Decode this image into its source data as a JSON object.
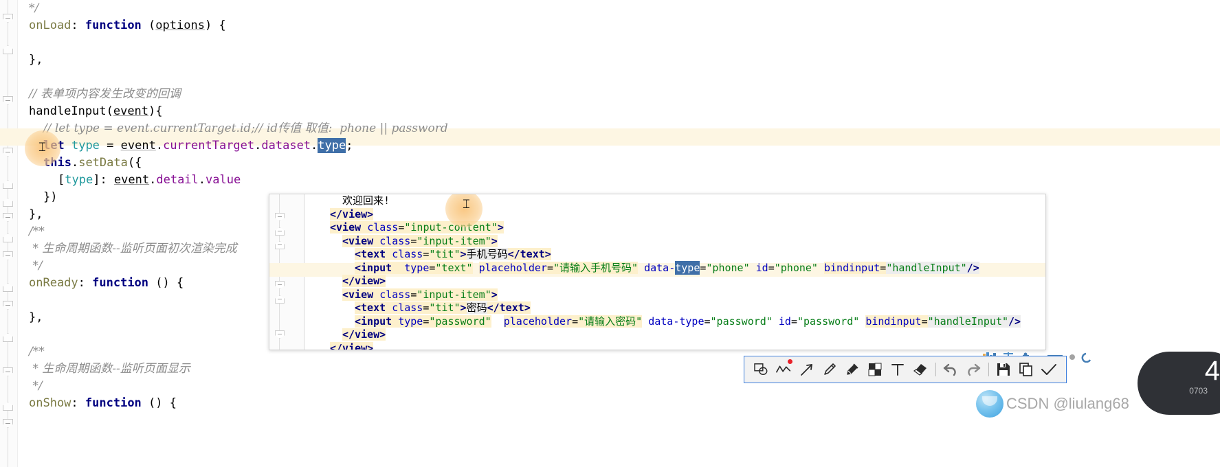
{
  "editor": {
    "lines": [
      {
        "indent": 0,
        "segments": [
          {
            "t": "*/",
            "c": "comment"
          }
        ]
      },
      {
        "indent": 0,
        "segments": [
          {
            "t": "onLoad",
            "c": "fn"
          },
          {
            "t": ": ",
            "c": "punc"
          },
          {
            "t": "function",
            "c": "kw"
          },
          {
            "t": " (",
            "c": "punc"
          },
          {
            "t": "options",
            "c": "param"
          },
          {
            "t": ") {",
            "c": "punc"
          }
        ]
      },
      {
        "indent": 0,
        "segments": []
      },
      {
        "indent": 0,
        "segments": [
          {
            "t": "},",
            "c": "punc"
          }
        ]
      },
      {
        "indent": 0,
        "segments": []
      },
      {
        "indent": 0,
        "segments": [
          {
            "t": "// 表单项内容发生改变的回调",
            "c": "comment"
          }
        ]
      },
      {
        "indent": 0,
        "segments": [
          {
            "t": "handleInput",
            "c": "ident"
          },
          {
            "t": "(",
            "c": "punc"
          },
          {
            "t": "event",
            "c": "param"
          },
          {
            "t": "){",
            "c": "punc"
          }
        ]
      },
      {
        "indent": 1,
        "segments": [
          {
            "t": "// let type = event.currentTarget.id;// id传值 取值:  phone || password",
            "c": "comment"
          }
        ]
      },
      {
        "indent": 1,
        "segments": [
          {
            "t": "let",
            "c": "kw"
          },
          {
            "t": " ",
            "c": "punc"
          },
          {
            "t": "type",
            "c": "teal"
          },
          {
            "t": " = ",
            "c": "punc"
          },
          {
            "t": "event",
            "c": "param"
          },
          {
            "t": ".",
            "c": "punc"
          },
          {
            "t": "currentTarget",
            "c": "field"
          },
          {
            "t": ".",
            "c": "punc"
          },
          {
            "t": "dataset",
            "c": "field"
          },
          {
            "t": ".",
            "c": "punc"
          },
          {
            "t": "type",
            "c": "sel"
          },
          {
            "t": ";",
            "c": "punc"
          }
        ],
        "highlight": true
      },
      {
        "indent": 1,
        "segments": [
          {
            "t": "this",
            "c": "kw"
          },
          {
            "t": ".",
            "c": "punc"
          },
          {
            "t": "setData",
            "c": "fn"
          },
          {
            "t": "({",
            "c": "punc"
          }
        ]
      },
      {
        "indent": 2,
        "segments": [
          {
            "t": "[",
            "c": "punc"
          },
          {
            "t": "type",
            "c": "teal"
          },
          {
            "t": "]: ",
            "c": "punc"
          },
          {
            "t": "event",
            "c": "param"
          },
          {
            "t": ".",
            "c": "punc"
          },
          {
            "t": "detail",
            "c": "field"
          },
          {
            "t": ".",
            "c": "punc"
          },
          {
            "t": "value",
            "c": "field"
          }
        ]
      },
      {
        "indent": 1,
        "segments": [
          {
            "t": "})",
            "c": "punc"
          }
        ]
      },
      {
        "indent": 0,
        "segments": [
          {
            "t": "},",
            "c": "punc"
          }
        ]
      },
      {
        "indent": 0,
        "segments": [
          {
            "t": "/**",
            "c": "comment"
          }
        ]
      },
      {
        "indent": 0,
        "segments": [
          {
            "t": " * 生命周期函数--监听页面初次渲染完成",
            "c": "comment"
          }
        ]
      },
      {
        "indent": 0,
        "segments": [
          {
            "t": " */",
            "c": "comment"
          }
        ]
      },
      {
        "indent": 0,
        "segments": [
          {
            "t": "onReady",
            "c": "fn"
          },
          {
            "t": ": ",
            "c": "punc"
          },
          {
            "t": "function",
            "c": "kw"
          },
          {
            "t": " () {",
            "c": "punc"
          }
        ]
      },
      {
        "indent": 0,
        "segments": []
      },
      {
        "indent": 0,
        "segments": [
          {
            "t": "},",
            "c": "punc"
          }
        ]
      },
      {
        "indent": 0,
        "segments": []
      },
      {
        "indent": 0,
        "segments": [
          {
            "t": "/**",
            "c": "comment"
          }
        ]
      },
      {
        "indent": 0,
        "segments": [
          {
            "t": " * 生命周期函数--监听页面显示",
            "c": "comment"
          }
        ]
      },
      {
        "indent": 0,
        "segments": [
          {
            "t": " */",
            "c": "comment"
          }
        ]
      },
      {
        "indent": 0,
        "segments": [
          {
            "t": "onShow",
            "c": "fn"
          },
          {
            "t": ": ",
            "c": "punc"
          },
          {
            "t": "function",
            "c": "kw"
          },
          {
            "t": " () {",
            "c": "punc"
          }
        ]
      }
    ]
  },
  "overlay": {
    "lines": [
      {
        "indent": 3,
        "segments": [
          {
            "t": "欢迎回来!",
            "c": "punc"
          }
        ]
      },
      {
        "indent": 2,
        "segments": [
          {
            "t": "</view>",
            "c": "tagname",
            "hl": true
          }
        ]
      },
      {
        "indent": 2,
        "segments": [
          {
            "t": "<view ",
            "c": "tagname",
            "hl": true
          },
          {
            "t": "class",
            "c": "attr",
            "hl": true
          },
          {
            "t": "=",
            "c": "punc",
            "hl": true
          },
          {
            "t": "\"input-content\"",
            "c": "str",
            "hl": true
          },
          {
            "t": ">",
            "c": "tagname",
            "hl": true
          }
        ]
      },
      {
        "indent": 3,
        "segments": [
          {
            "t": "<view ",
            "c": "tagname",
            "hl": true
          },
          {
            "t": "class",
            "c": "attr",
            "hl": true
          },
          {
            "t": "=",
            "c": "punc",
            "hl": true
          },
          {
            "t": "\"input-item\"",
            "c": "str",
            "hl": true
          },
          {
            "t": ">",
            "c": "tagname",
            "hl": true
          }
        ]
      },
      {
        "indent": 4,
        "segments": [
          {
            "t": "<text ",
            "c": "tagname",
            "hl": true
          },
          {
            "t": "class",
            "c": "attr",
            "hl": true
          },
          {
            "t": "=",
            "c": "punc",
            "hl": true
          },
          {
            "t": "\"tit\"",
            "c": "str",
            "hl": true
          },
          {
            "t": ">",
            "c": "tagname",
            "hl": true
          },
          {
            "t": "手机号码",
            "c": "punc",
            "hl2": true
          },
          {
            "t": "</text>",
            "c": "tagname",
            "hl": true
          }
        ]
      },
      {
        "indent": 4,
        "segments": [
          {
            "t": "<input  ",
            "c": "tagname",
            "hl": true
          },
          {
            "t": "type",
            "c": "attr",
            "hl": true
          },
          {
            "t": "=",
            "c": "punc",
            "hl": true
          },
          {
            "t": "\"text\"",
            "c": "str",
            "hl": true
          },
          {
            "t": " ",
            "c": "punc"
          },
          {
            "t": "placeholder",
            "c": "attr",
            "hl": true
          },
          {
            "t": "=",
            "c": "punc",
            "hl": true
          },
          {
            "t": "\"请输入手机号码\"",
            "c": "str",
            "hl": true
          },
          {
            "t": " ",
            "c": "punc"
          },
          {
            "t": "data-",
            "c": "attr"
          },
          {
            "t": "type",
            "c": "sel"
          },
          {
            "t": "=",
            "c": "punc"
          },
          {
            "t": "\"phone\"",
            "c": "str"
          },
          {
            "t": " ",
            "c": "punc"
          },
          {
            "t": "id",
            "c": "attr"
          },
          {
            "t": "=",
            "c": "punc"
          },
          {
            "t": "\"phone\"",
            "c": "str"
          },
          {
            "t": " ",
            "c": "punc"
          },
          {
            "t": "bindinput",
            "c": "attr",
            "hl": true
          },
          {
            "t": "=",
            "c": "punc",
            "hl": true
          },
          {
            "t": "\"handleInput\"",
            "c": "str",
            "hl2": true
          },
          {
            "t": "/>",
            "c": "tagname",
            "hl2": true
          }
        ],
        "highlight": true,
        "bulb": true
      },
      {
        "indent": 3,
        "segments": [
          {
            "t": "</view>",
            "c": "tagname",
            "hl": true
          }
        ]
      },
      {
        "indent": 3,
        "segments": [
          {
            "t": "<view ",
            "c": "tagname",
            "hl": true
          },
          {
            "t": "class",
            "c": "attr",
            "hl": true
          },
          {
            "t": "=",
            "c": "punc",
            "hl": true
          },
          {
            "t": "\"input-item\"",
            "c": "str",
            "hl": true
          },
          {
            "t": ">",
            "c": "tagname",
            "hl": true
          }
        ]
      },
      {
        "indent": 4,
        "segments": [
          {
            "t": "<text ",
            "c": "tagname",
            "hl": true
          },
          {
            "t": "class",
            "c": "attr",
            "hl": true
          },
          {
            "t": "=",
            "c": "punc",
            "hl": true
          },
          {
            "t": "\"tit\"",
            "c": "str",
            "hl": true
          },
          {
            "t": ">",
            "c": "tagname",
            "hl": true
          },
          {
            "t": "密码",
            "c": "punc",
            "hl2": true
          },
          {
            "t": "</text>",
            "c": "tagname",
            "hl": true
          }
        ]
      },
      {
        "indent": 4,
        "segments": [
          {
            "t": "<input ",
            "c": "tagname",
            "hl": true
          },
          {
            "t": "type",
            "c": "attr",
            "hl": true
          },
          {
            "t": "=",
            "c": "punc",
            "hl": true
          },
          {
            "t": "\"password\"",
            "c": "str",
            "hl": true
          },
          {
            "t": "  ",
            "c": "punc"
          },
          {
            "t": "placeholder",
            "c": "attr",
            "hl": true
          },
          {
            "t": "=",
            "c": "punc",
            "hl": true
          },
          {
            "t": "\"请输入密码\"",
            "c": "str",
            "hl": true
          },
          {
            "t": " ",
            "c": "punc"
          },
          {
            "t": "data-type",
            "c": "attr"
          },
          {
            "t": "=",
            "c": "punc"
          },
          {
            "t": "\"password\"",
            "c": "str"
          },
          {
            "t": " ",
            "c": "punc"
          },
          {
            "t": "id",
            "c": "attr"
          },
          {
            "t": "=",
            "c": "punc"
          },
          {
            "t": "\"password\"",
            "c": "str"
          },
          {
            "t": " ",
            "c": "punc"
          },
          {
            "t": "bindinput",
            "c": "attr",
            "hl": true
          },
          {
            "t": "=",
            "c": "punc",
            "hl": true
          },
          {
            "t": "\"handleInput\"",
            "c": "str",
            "hl2": true
          },
          {
            "t": "/>",
            "c": "tagname",
            "hl2": true
          }
        ]
      },
      {
        "indent": 3,
        "segments": [
          {
            "t": "</view>",
            "c": "tagname",
            "hl": true
          }
        ]
      },
      {
        "indent": 2,
        "segments": [
          {
            "t": "</view>",
            "c": "tagname",
            "hl": true
          }
        ]
      }
    ]
  },
  "toolbar": {
    "items": [
      {
        "icon": "shape-select-icon",
        "label": "Shape select",
        "type": "button",
        "badge": false
      },
      {
        "icon": "squiggly-line-icon",
        "label": "Squiggly line",
        "type": "button",
        "badge": true
      },
      {
        "icon": "arrow-icon",
        "label": "Arrow",
        "type": "button",
        "badge": false
      },
      {
        "icon": "pencil-icon",
        "label": "Pencil",
        "type": "button",
        "badge": false
      },
      {
        "icon": "highlighter-icon",
        "label": "Highlighter",
        "type": "button",
        "badge": false
      },
      {
        "icon": "mosaic-icon",
        "label": "Mosaic",
        "type": "button",
        "badge": false
      },
      {
        "icon": "text-icon",
        "label": "Text",
        "type": "button",
        "badge": false
      },
      {
        "icon": "eraser-icon",
        "label": "Eraser",
        "type": "button",
        "badge": false
      },
      {
        "icon": "separator",
        "label": "",
        "type": "separator",
        "badge": false
      },
      {
        "icon": "undo-icon",
        "label": "Undo",
        "type": "button",
        "badge": false
      },
      {
        "icon": "redo-icon",
        "label": "Redo",
        "type": "button",
        "badge": false
      },
      {
        "icon": "separator",
        "label": "",
        "type": "separator",
        "badge": false
      },
      {
        "icon": "save-icon",
        "label": "Save",
        "type": "button",
        "badge": false
      },
      {
        "icon": "copy-icon",
        "label": "Copy",
        "type": "button",
        "badge": false
      },
      {
        "icon": "confirm-check-icon",
        "label": "Confirm",
        "type": "button",
        "badge": false
      }
    ]
  },
  "watermark": {
    "text": "CSDN @liulang68"
  },
  "overlay_badge": {
    "number": "4",
    "sub": "0703"
  },
  "colors": {
    "accent_blue": "#3b7ddd",
    "highlight_line": "#fdf6e3",
    "selection": "#3f6fa8",
    "string_green": "#067d17",
    "attr_blue": "#0000c0",
    "tag_navy": "#000080",
    "comment_gray": "#8c8c8c",
    "badge_red": "#e8212a"
  }
}
